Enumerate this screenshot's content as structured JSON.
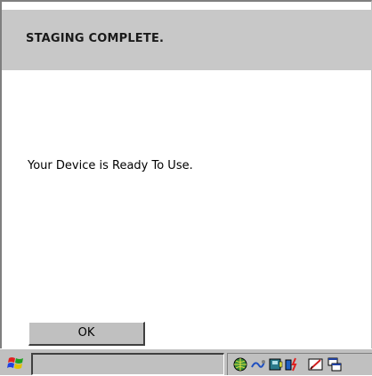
{
  "dialog": {
    "title": "STAGING COMPLETE.",
    "message": "Your Device is Ready To Use.",
    "ok_label": "OK"
  },
  "taskbar": {
    "start_icon": "windows-flag-icon",
    "tray_icons": [
      "network-globe-icon",
      "connection-icon",
      "storage-icon",
      "battery-power-icon",
      "input-pen-icon",
      "window-switch-icon"
    ]
  },
  "colors": {
    "header_bg": "#c8c8c8",
    "taskbar_bg": "#c0c0c0"
  }
}
